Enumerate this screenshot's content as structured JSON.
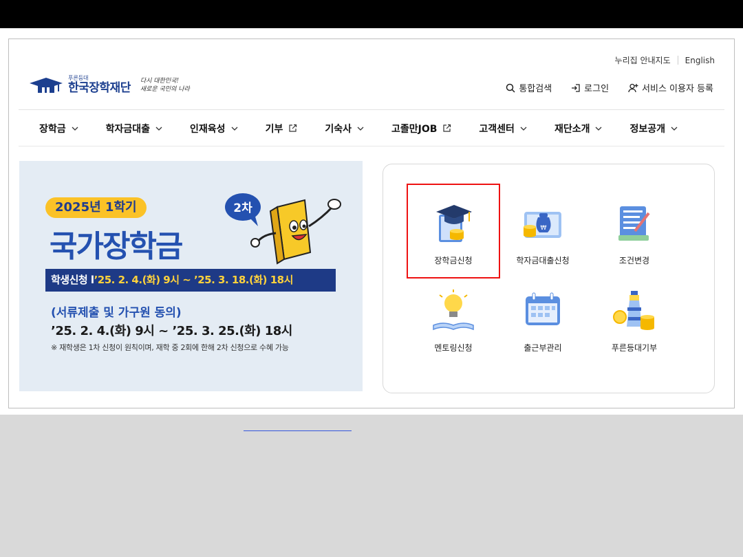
{
  "util": {
    "guide": "누리집 안내지도",
    "english": "English"
  },
  "logo": {
    "small": "푸른등대",
    "name": "한국장학재단",
    "slogan1": "다시 대한민국!",
    "slogan2": "새로운 국민의 나라"
  },
  "header_menu": [
    {
      "label": "통합검색",
      "icon": "search-icon"
    },
    {
      "label": "로그인",
      "icon": "login-icon"
    },
    {
      "label": "서비스 이용자 등록",
      "icon": "user-add-icon"
    }
  ],
  "gnb": [
    {
      "label": "장학금",
      "icon": "chevron-down-icon"
    },
    {
      "label": "학자금대출",
      "icon": "chevron-down-icon"
    },
    {
      "label": "인재육성",
      "icon": "chevron-down-icon"
    },
    {
      "label": "기부",
      "icon": "external-link-icon"
    },
    {
      "label": "기숙사",
      "icon": "chevron-down-icon"
    },
    {
      "label": "고졸만JOB",
      "icon": "external-link-icon"
    },
    {
      "label": "고객센터",
      "icon": "chevron-down-icon"
    },
    {
      "label": "재단소개",
      "icon": "chevron-down-icon"
    },
    {
      "label": "정보공개",
      "icon": "chevron-down-icon"
    }
  ],
  "banner": {
    "pill": "2025년 1학기",
    "title": "국가장학금",
    "badge": "2차",
    "apply_label": "학생신청 l",
    "apply_period": "’25. 2. 4.(화) 9시 ~ ’25. 3. 18.(화) 18시",
    "sub1": "(서류제출 및 가구원 동의)",
    "sub2": "’25. 2. 4.(화) 9시 ~ ’25. 3. 25.(화) 18시",
    "note": "※ 재학생은 1차 신청이 원칙이며, 재학 중 2회에 한해 2차 신청으로 수혜 가능"
  },
  "services": [
    {
      "label": "장학금신청",
      "icon": "graduation-cap-icon"
    },
    {
      "label": "학자금대출신청",
      "icon": "money-bag-icon"
    },
    {
      "label": "조건변경",
      "icon": "document-edit-icon"
    },
    {
      "label": "멘토링신청",
      "icon": "lightbulb-icon"
    },
    {
      "label": "출근부관리",
      "icon": "calendar-icon"
    },
    {
      "label": "푸른등대기부",
      "icon": "lighthouse-icon"
    }
  ],
  "colors": {
    "brand": "#1c3f8f",
    "accent": "#fbc227",
    "highlight": "#e11111",
    "banner_bg": "#e4ecf4"
  }
}
